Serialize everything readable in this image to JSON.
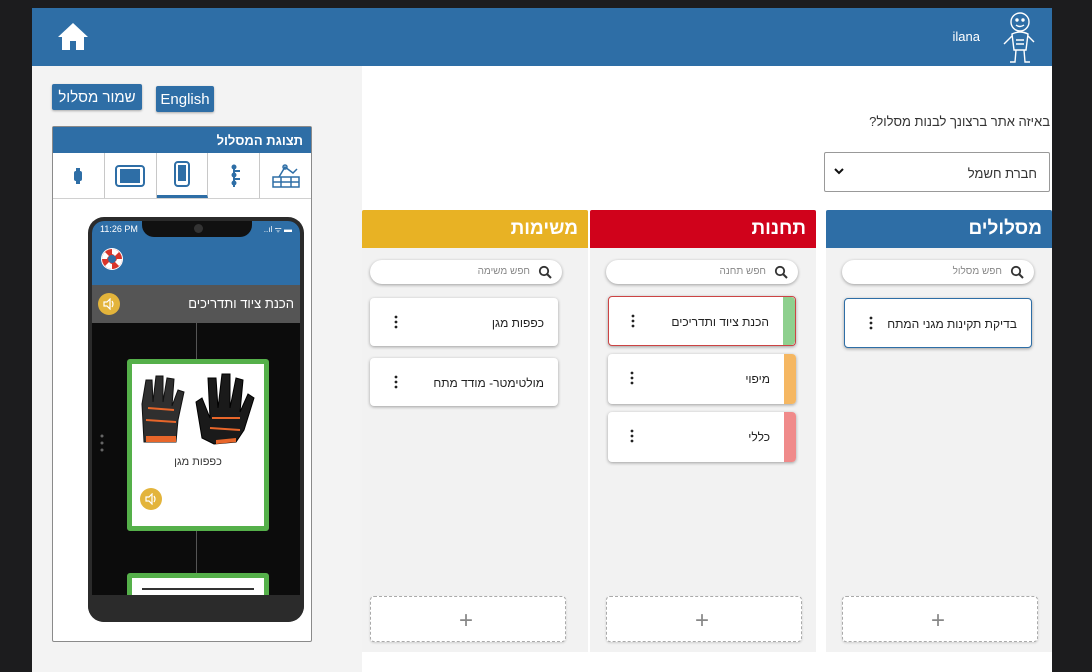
{
  "header": {
    "username": "ilana",
    "home_icon": "home-icon",
    "avatar_icon": "stick-figure-avatar",
    "color": "#2e6ea6"
  },
  "left_panel": {
    "save_route_label": "שמור מסלול",
    "english_label": "English",
    "preview_title": "תצוגת המסלול",
    "view_tabs": [
      {
        "icon": "map-view-icon"
      },
      {
        "icon": "route-list-icon"
      },
      {
        "icon": "phone-icon",
        "active": true
      },
      {
        "icon": "tablet-icon"
      },
      {
        "icon": "watch-icon"
      }
    ],
    "phone": {
      "time": "11:26 PM",
      "status_icons": "..ıl ᯤ ▬",
      "station_title": "הכנת ציוד ותדריכים",
      "task_label": "כפפות מגן"
    }
  },
  "main": {
    "question": "באיזה אתר ברצונך לבנות מסלול?",
    "company_select_value": "חברת חשמל",
    "add_symbol": "+"
  },
  "columns": {
    "routes": {
      "title": "מסלולים",
      "color": "#2e6ea6",
      "search_placeholder": "חפש מסלול",
      "items": [
        {
          "label": "בדיקת תקינות מגני המתח"
        }
      ]
    },
    "stations": {
      "title": "תחנות",
      "color": "#d0021b",
      "search_placeholder": "חפש תחנה",
      "items": [
        {
          "label": "הכנת ציוד ותדריכים",
          "stripe": "#8ed08e"
        },
        {
          "label": "מיפוי",
          "stripe": "#f5b762"
        },
        {
          "label": "כללי",
          "stripe": "#f08a8a"
        }
      ]
    },
    "tasks": {
      "title": "משימות",
      "color": "#e8b224",
      "search_placeholder": "חפש משימה",
      "items": [
        {
          "label": "כפפות מגן"
        },
        {
          "label": "מולטימטר- מודד מתח"
        }
      ]
    }
  }
}
